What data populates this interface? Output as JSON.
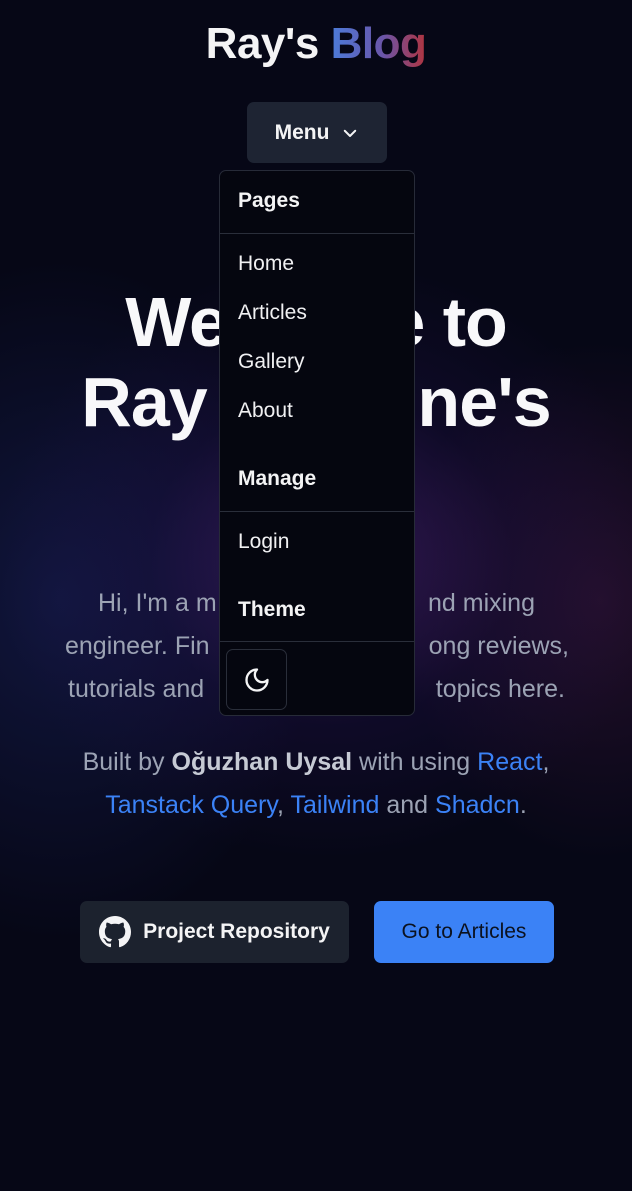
{
  "header": {
    "brand_first": "Ray's",
    "brand_second": "Blog",
    "menu_label": "Menu",
    "menu_icon": "chevron-down-icon"
  },
  "hero": {
    "title_line1": "Welcome to",
    "title_line2": "Ray Lorthine's",
    "intro_visible": [
      "Hi, I'm a m",
      "nd mixing",
      "engineer. Fin",
      "ong reviews,",
      "tutorials and",
      "topics here."
    ],
    "built_by": {
      "prefix": "Built by ",
      "author": "Oğuzhan Uysal",
      "middle": " with using ",
      "link_react": "React",
      "comma1": ",",
      "link_tanstack": "Tanstack Query",
      "comma2": ", ",
      "link_tailwind": "Tailwind",
      "and": " and ",
      "link_shadcn": "Shadcn",
      "period": "."
    }
  },
  "actions": {
    "repo_label": "Project Repository",
    "repo_icon": "github-icon",
    "articles_label": "Go to Articles"
  },
  "dropdown": {
    "pages_heading": "Pages",
    "pages": [
      "Home",
      "Articles",
      "Gallery",
      "About"
    ],
    "manage_heading": "Manage",
    "manage_items": [
      "Login"
    ],
    "theme_heading": "Theme",
    "theme_icon": "moon-icon"
  },
  "colors": {
    "accent": "#3b82f6",
    "background": "#060716",
    "button_dark": "#1c222e"
  }
}
